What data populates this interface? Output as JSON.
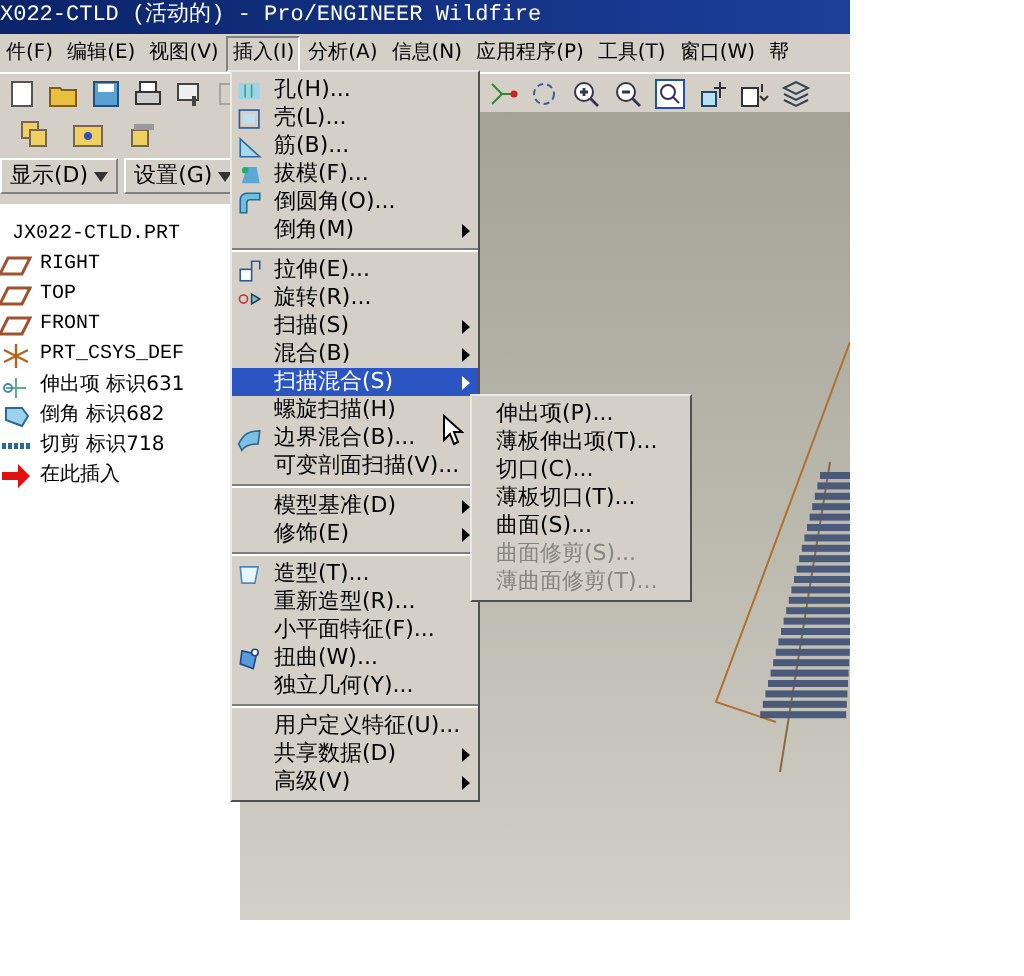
{
  "window": {
    "title": "X022-CTLD (活动的) - Pro/ENGINEER Wildfire"
  },
  "menubar": [
    {
      "label": "件(F)",
      "selected": false
    },
    {
      "label": "编辑(E)",
      "selected": false
    },
    {
      "label": "视图(V)",
      "selected": false
    },
    {
      "label": "插入(I)",
      "selected": true
    },
    {
      "label": "分析(A)",
      "selected": false
    },
    {
      "label": "信息(N)",
      "selected": false
    },
    {
      "label": "应用程序(P)",
      "selected": false
    },
    {
      "label": "工具(T)",
      "selected": false
    },
    {
      "label": "窗口(W)",
      "selected": false
    },
    {
      "label": "帮",
      "selected": false
    }
  ],
  "panel_buttons": [
    "显示(D)",
    "设置(G)"
  ],
  "model_tree": [
    {
      "label": "JX022-CTLD.PRT",
      "kind": "root"
    },
    {
      "label": "RIGHT",
      "kind": "plane"
    },
    {
      "label": "TOP",
      "kind": "plane"
    },
    {
      "label": "FRONT",
      "kind": "plane"
    },
    {
      "label": "PRT_CSYS_DEF",
      "kind": "csys"
    },
    {
      "label": "伸出项 标识631",
      "kind": "protrusion"
    },
    {
      "label": "倒角 标识682",
      "kind": "chamfer"
    },
    {
      "label": "切剪 标识718",
      "kind": "cut"
    },
    {
      "label": "在此插入",
      "kind": "insert"
    }
  ],
  "insert_menu": [
    {
      "kind": "item",
      "label": "孔(H)...",
      "submenu": false,
      "selected": false
    },
    {
      "kind": "item",
      "label": "壳(L)...",
      "submenu": false,
      "selected": false
    },
    {
      "kind": "item",
      "label": "筋(B)...",
      "submenu": false,
      "selected": false
    },
    {
      "kind": "item",
      "label": "拔模(F)...",
      "submenu": false,
      "selected": false
    },
    {
      "kind": "item",
      "label": "倒圆角(O)...",
      "submenu": false,
      "selected": false
    },
    {
      "kind": "item",
      "label": "倒角(M)",
      "submenu": true,
      "selected": false
    },
    {
      "kind": "separator"
    },
    {
      "kind": "item",
      "label": "拉伸(E)...",
      "submenu": false,
      "selected": false
    },
    {
      "kind": "item",
      "label": "旋转(R)...",
      "submenu": false,
      "selected": false
    },
    {
      "kind": "item",
      "label": "扫描(S)",
      "submenu": true,
      "selected": false
    },
    {
      "kind": "item",
      "label": "混合(B)",
      "submenu": true,
      "selected": false
    },
    {
      "kind": "item",
      "label": "扫描混合(S)",
      "submenu": true,
      "selected": true
    },
    {
      "kind": "item",
      "label": "螺旋扫描(H)",
      "submenu": false,
      "selected": false
    },
    {
      "kind": "item",
      "label": "边界混合(B)...",
      "submenu": false,
      "selected": false
    },
    {
      "kind": "item",
      "label": "可变剖面扫描(V)...",
      "submenu": false,
      "selected": false
    },
    {
      "kind": "separator"
    },
    {
      "kind": "item",
      "label": "模型基准(D)",
      "submenu": true,
      "selected": false
    },
    {
      "kind": "item",
      "label": "修饰(E)",
      "submenu": true,
      "selected": false
    },
    {
      "kind": "separator"
    },
    {
      "kind": "item",
      "label": "造型(T)...",
      "submenu": false,
      "selected": false
    },
    {
      "kind": "item",
      "label": "重新造型(R)...",
      "submenu": false,
      "selected": false
    },
    {
      "kind": "item",
      "label": "小平面特征(F)...",
      "submenu": false,
      "selected": false
    },
    {
      "kind": "item",
      "label": "扭曲(W)...",
      "submenu": false,
      "selected": false
    },
    {
      "kind": "item",
      "label": "独立几何(Y)...",
      "submenu": false,
      "selected": false
    },
    {
      "kind": "separator"
    },
    {
      "kind": "item",
      "label": "用户定义特征(U)...",
      "submenu": false,
      "selected": false
    },
    {
      "kind": "item",
      "label": "共享数据(D)",
      "submenu": true,
      "selected": false
    },
    {
      "kind": "item",
      "label": "高级(V)",
      "submenu": true,
      "selected": false
    }
  ],
  "submenu": [
    {
      "label": "伸出项(P)...",
      "disabled": false
    },
    {
      "label": "薄板伸出项(T)...",
      "disabled": false
    },
    {
      "label": "切口(C)...",
      "disabled": false
    },
    {
      "label": "薄板切口(T)...",
      "disabled": false
    },
    {
      "label": "曲面(S)...",
      "disabled": false
    },
    {
      "label": "曲面修剪(S)...",
      "disabled": true
    },
    {
      "label": "薄曲面修剪(T)...",
      "disabled": true
    }
  ]
}
